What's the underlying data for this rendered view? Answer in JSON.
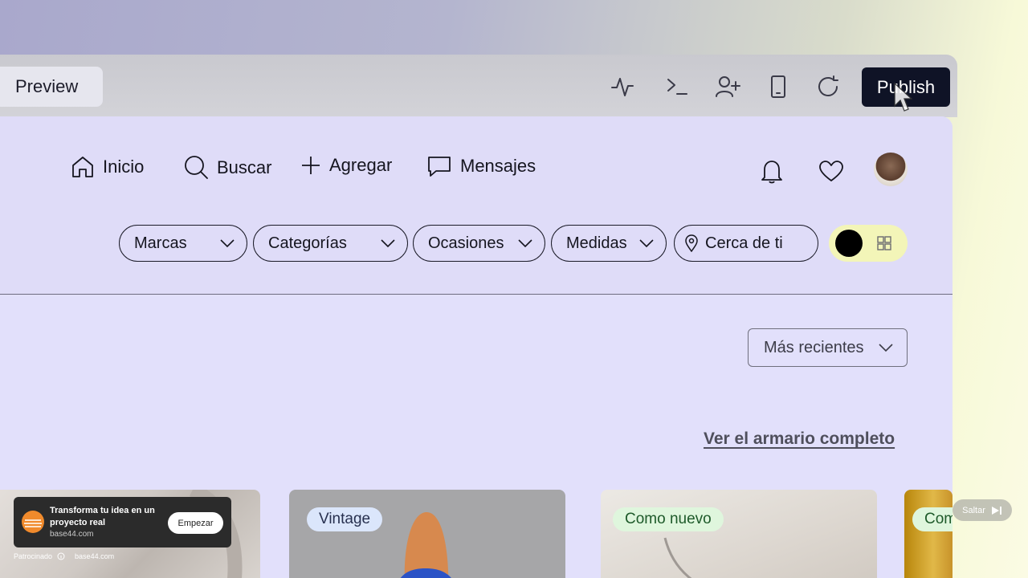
{
  "toolbar": {
    "preview_label": "Preview",
    "publish_label": "Publish",
    "icons": [
      "activity-icon",
      "terminal-icon",
      "add-user-icon",
      "mobile-icon",
      "refresh-icon"
    ]
  },
  "nav": {
    "items": [
      {
        "label": "Inicio",
        "icon": "home-icon"
      },
      {
        "label": "Buscar",
        "icon": "search-icon"
      },
      {
        "label": "Agregar",
        "icon": "plus-icon"
      },
      {
        "label": "Mensajes",
        "icon": "message-icon"
      }
    ]
  },
  "filters": [
    {
      "label": "Marcas"
    },
    {
      "label": "Categorías"
    },
    {
      "label": "Ocasiones"
    },
    {
      "label": "Medidas"
    },
    {
      "label": "Cerca de ti",
      "icon": "location-pin-icon"
    }
  ],
  "sort": {
    "selected": "Más recientes"
  },
  "closet_link": "Ver el armario completo",
  "cards": [
    {
      "badge": ""
    },
    {
      "badge": "Vintage"
    },
    {
      "badge": "Como nuevo"
    },
    {
      "badge": "Com"
    }
  ],
  "ad": {
    "title": "Transforma tu idea en un proyecto real",
    "domain": "base44.com",
    "cta": "Empezar",
    "sponsored_label": "Patrocinado",
    "sponsored_domain": "base44.com",
    "skip_label": "Saltar"
  },
  "colors": {
    "publish_bg": "#0f1326",
    "app_bg": "#e2e0fb",
    "toggle_bg": "#f3f5b8",
    "badge_vintage_bg": "#dbe6fb",
    "badge_nuevo_bg": "#dff6dd"
  }
}
